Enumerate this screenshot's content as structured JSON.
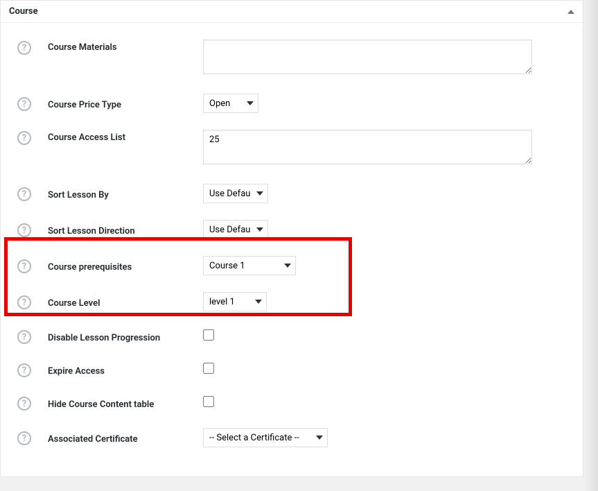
{
  "panel": {
    "title": "Course"
  },
  "help_glyph": "?",
  "rows": {
    "materials": {
      "label": "Course Materials",
      "value": ""
    },
    "price_type": {
      "label": "Course Price Type",
      "value": "Open"
    },
    "access_list": {
      "label": "Course Access List",
      "value": "25"
    },
    "sort_lesson_by": {
      "label": "Sort Lesson By",
      "value": "Use Default"
    },
    "sort_lesson_dir": {
      "label": "Sort Lesson Direction",
      "value": "Use Default"
    },
    "prerequisites": {
      "label": "Course prerequisites",
      "value": "Course 1"
    },
    "level": {
      "label": "Course Level",
      "value": "level 1"
    },
    "disable_progression": {
      "label": "Disable Lesson Progression"
    },
    "expire_access": {
      "label": "Expire Access"
    },
    "hide_content_table": {
      "label": "Hide Course Content table"
    },
    "certificate": {
      "label": "Associated Certificate",
      "value": "-- Select a Certificate --"
    }
  }
}
